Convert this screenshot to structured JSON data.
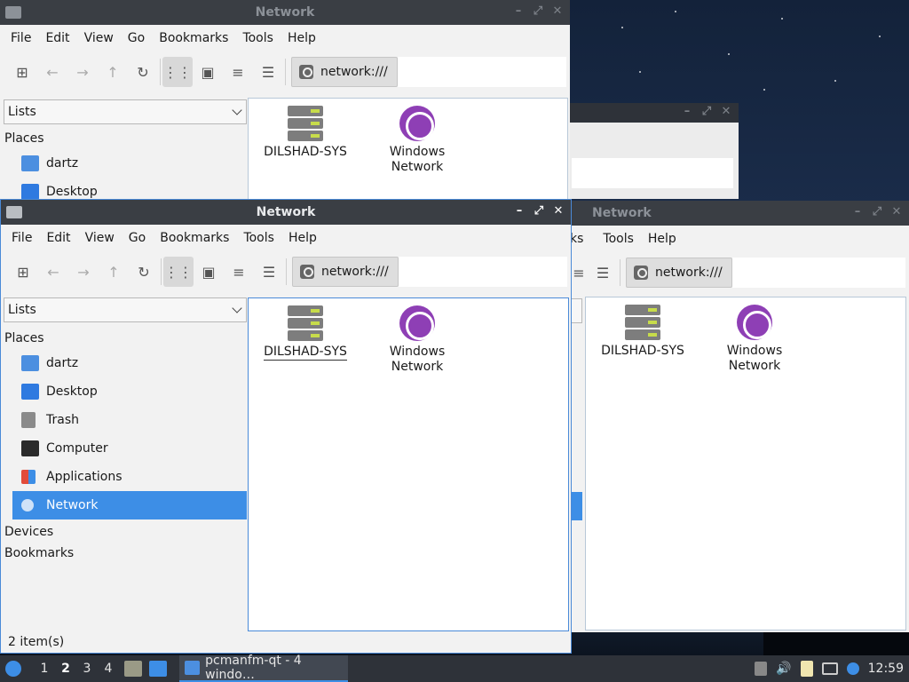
{
  "windows": {
    "title": "Network",
    "menu": [
      "File",
      "Edit",
      "View",
      "Go",
      "Bookmarks",
      "Tools",
      "Help"
    ],
    "address": "network:///",
    "side_mode": "Lists",
    "sections": {
      "places": "Places",
      "devices": "Devices",
      "bookmarks": "Bookmarks"
    },
    "places": [
      {
        "label": "dartz",
        "icon": "home-folder-icon"
      },
      {
        "label": "Desktop",
        "icon": "desktop-icon"
      },
      {
        "label": "Trash",
        "icon": "trash-icon"
      },
      {
        "label": "Computer",
        "icon": "computer-icon"
      },
      {
        "label": "Applications",
        "icon": "applications-icon"
      },
      {
        "label": "Network",
        "icon": "network-icon"
      }
    ],
    "files": [
      {
        "label": "DILSHAD-SYS",
        "icon": "server-icon"
      },
      {
        "label1": "Windows",
        "label2": "Network",
        "icon": "globe-icon"
      }
    ],
    "status": "2 item(s)",
    "right_menu_partial": [
      "ks",
      "Tools",
      "Help"
    ]
  },
  "taskbar": {
    "desktops": [
      "1",
      "2",
      "3",
      "4"
    ],
    "current_desktop": "2",
    "task_label": "pcmanfm-qt - 4 windo…",
    "clock": "12:59"
  },
  "colors": {
    "accent": "#3d8ee6",
    "titlebar": "#3a3e44",
    "taskbar": "#2e3239"
  }
}
